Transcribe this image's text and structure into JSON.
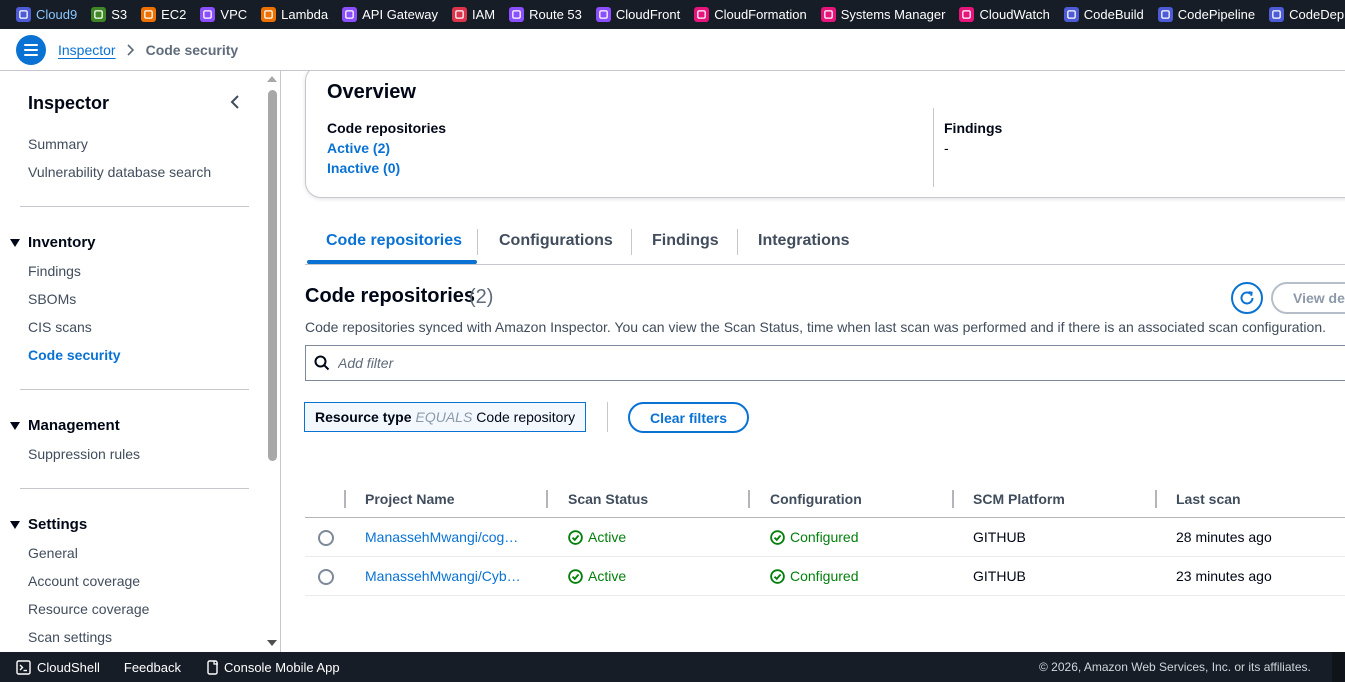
{
  "services": [
    {
      "name": "cloud9-icon",
      "label": "Cloud9",
      "color": "#4d5bd6",
      "active": true
    },
    {
      "name": "s3-icon",
      "label": "S3",
      "color": "#3f8624"
    },
    {
      "name": "ec2-icon",
      "label": "EC2",
      "color": "#ed7100"
    },
    {
      "name": "vpc-icon",
      "label": "VPC",
      "color": "#8c4fff"
    },
    {
      "name": "lambda-icon",
      "label": "Lambda",
      "color": "#ed7100"
    },
    {
      "name": "api-gateway-icon",
      "label": "API Gateway",
      "color": "#8c4fff"
    },
    {
      "name": "iam-icon",
      "label": "IAM",
      "color": "#dd344c"
    },
    {
      "name": "route53-icon",
      "label": "Route 53",
      "color": "#8c4fff"
    },
    {
      "name": "cloudfront-icon",
      "label": "CloudFront",
      "color": "#8c4fff"
    },
    {
      "name": "cloudformation-icon",
      "label": "CloudFormation",
      "color": "#e7157b"
    },
    {
      "name": "systems-manager-icon",
      "label": "Systems Manager",
      "color": "#e7157b"
    },
    {
      "name": "cloudwatch-icon",
      "label": "CloudWatch",
      "color": "#e7157b"
    },
    {
      "name": "codebuild-icon",
      "label": "CodeBuild",
      "color": "#4d5bd6"
    },
    {
      "name": "codepipeline-icon",
      "label": "CodePipeline",
      "color": "#4d5bd6"
    },
    {
      "name": "codedeploy-icon",
      "label": "CodeDeploy",
      "color": "#4d5bd6"
    },
    {
      "name": "more-service-icon",
      "label": "",
      "color": "#3f8624"
    }
  ],
  "breadcrumb": {
    "parent": "Inspector",
    "current": "Code security"
  },
  "sidebar": {
    "title": "Inspector",
    "top_links": [
      "Summary",
      "Vulnerability database search"
    ],
    "sections": [
      {
        "label": "Inventory",
        "links": [
          "Findings",
          "SBOMs",
          "CIS scans",
          "Code security"
        ]
      },
      {
        "label": "Management",
        "links": [
          "Suppression rules"
        ]
      },
      {
        "label": "Settings",
        "links": [
          "General",
          "Account coverage",
          "Resource coverage",
          "Scan settings"
        ]
      }
    ],
    "active_link": "Code security"
  },
  "overview": {
    "title": "Overview",
    "repos_label": "Code repositories",
    "active_link": "Active (2)",
    "inactive_link": "Inactive (0)",
    "findings_label": "Findings",
    "findings_value": "-"
  },
  "tabs": [
    "Code repositories",
    "Configurations",
    "Findings",
    "Integrations"
  ],
  "active_tab": "Code repositories",
  "section": {
    "title": "Code repositories",
    "count": "(2)",
    "description": "Code repositories synced with Amazon Inspector. You can view the Scan Status, time when last scan was performed and if there is an associated scan configuration.",
    "view_button": "View de"
  },
  "filter": {
    "placeholder": "Add filter"
  },
  "token": {
    "key": "Resource type",
    "operator": "EQUALS",
    "value": "Code repository"
  },
  "clear_filters": "Clear filters",
  "table": {
    "columns": [
      "Project Name",
      "Scan Status",
      "Configuration",
      "SCM Platform",
      "Last scan"
    ],
    "rows": [
      {
        "project": "ManassehMwangi/cog…",
        "status": "Active",
        "config": "Configured",
        "scm": "GITHUB",
        "last_scan": "28 minutes ago"
      },
      {
        "project": "ManassehMwangi/Cyb…",
        "status": "Active",
        "config": "Configured",
        "scm": "GITHUB",
        "last_scan": "23 minutes ago"
      }
    ]
  },
  "footer": {
    "cloudshell": "CloudShell",
    "feedback": "Feedback",
    "mobile_app": "Console Mobile App",
    "copyright": "© 2026, Amazon Web Services, Inc. or its affiliates."
  },
  "colors": {
    "link": "#0972d3",
    "success": "#037f0c",
    "topbar": "#161d26"
  }
}
